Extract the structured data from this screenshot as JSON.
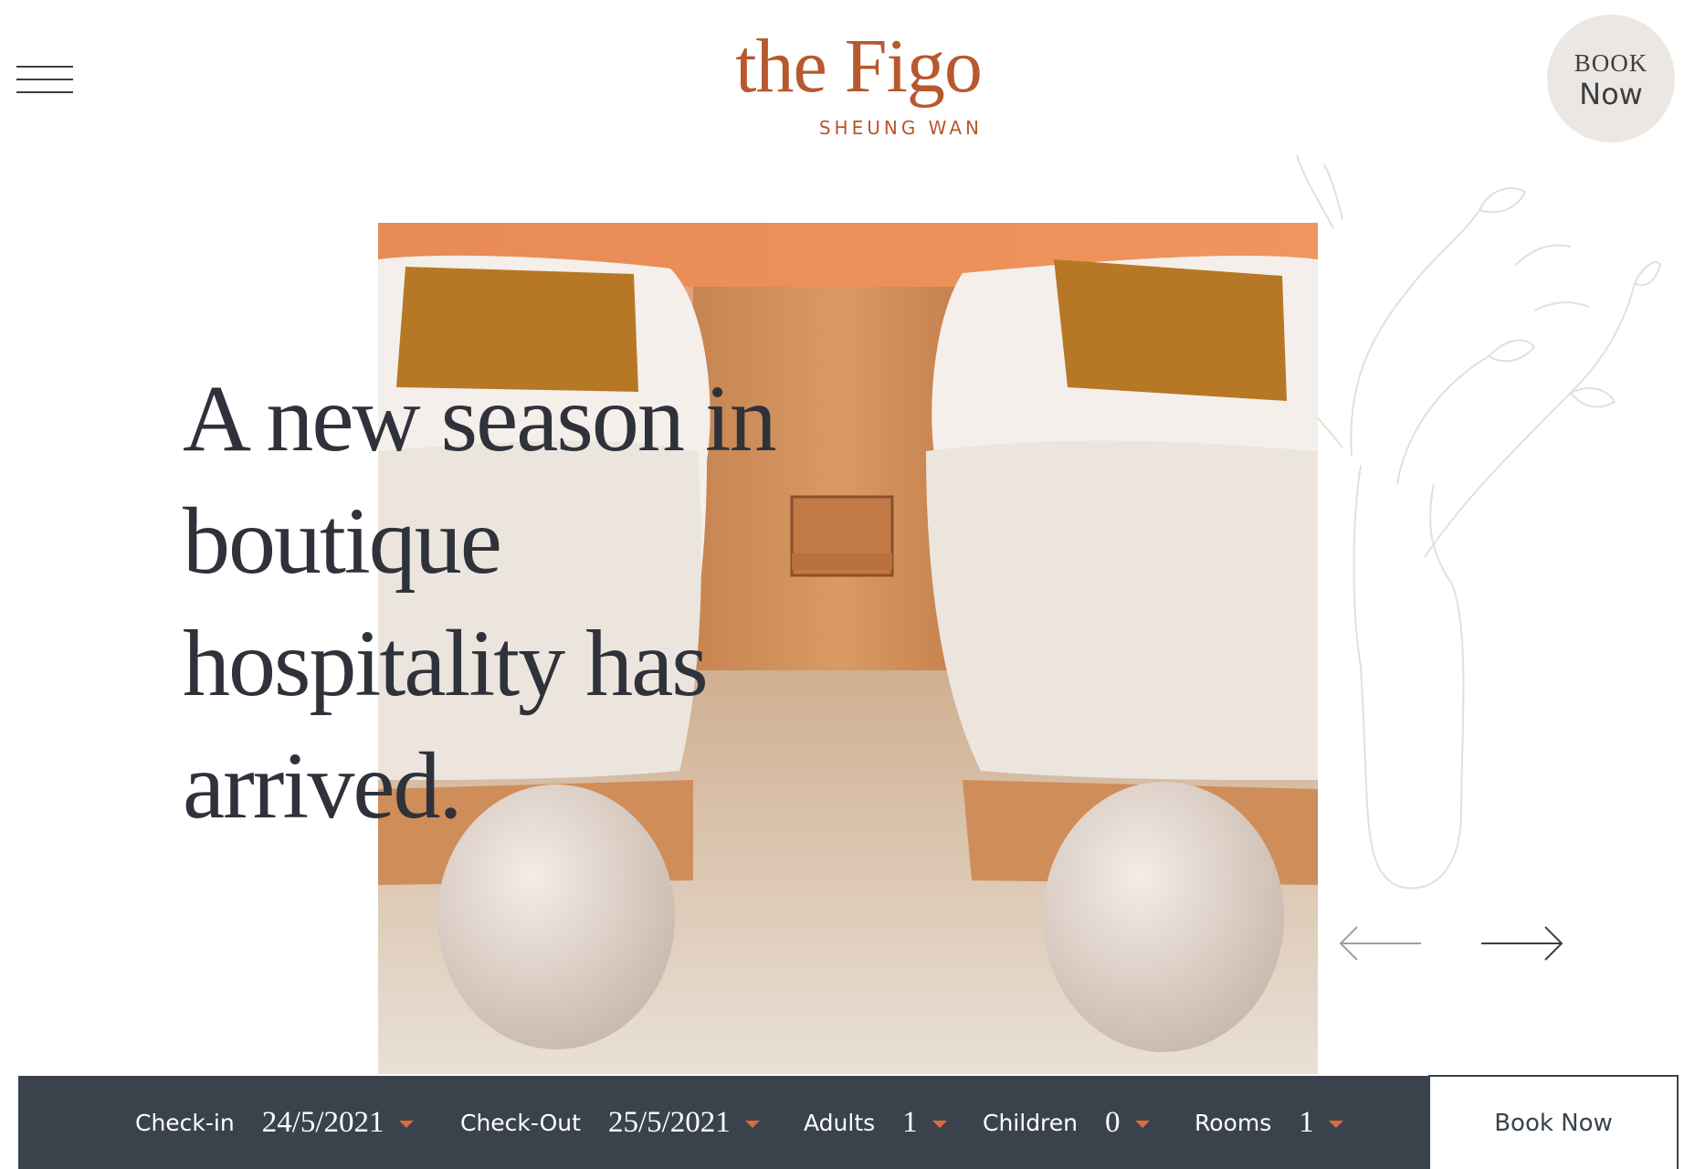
{
  "header": {
    "logo_name": "the Figo",
    "logo_location": "SHEUNG WAN",
    "book_line1": "BOOK",
    "book_line2": "Now"
  },
  "hero": {
    "headline_lines": [
      "A new season in",
      "boutique",
      "hospitality has",
      "arrived."
    ]
  },
  "booking": {
    "checkin_label": "Check-in",
    "checkin_value": "24/5/2021",
    "checkout_label": "Check-Out",
    "checkout_value": "25/5/2021",
    "adults_label": "Adults",
    "adults_value": "1",
    "children_label": "Children",
    "children_value": "0",
    "rooms_label": "Rooms",
    "rooms_value": "1",
    "submit_label": "Book Now"
  },
  "colors": {
    "brand": "#b8582e",
    "bar": "#3a434c",
    "caret": "#e06a3b",
    "headline": "#2f323a"
  },
  "icons": [
    "menu-icon",
    "arrow-left-icon",
    "arrow-right-icon",
    "chevron-down-icon"
  ]
}
